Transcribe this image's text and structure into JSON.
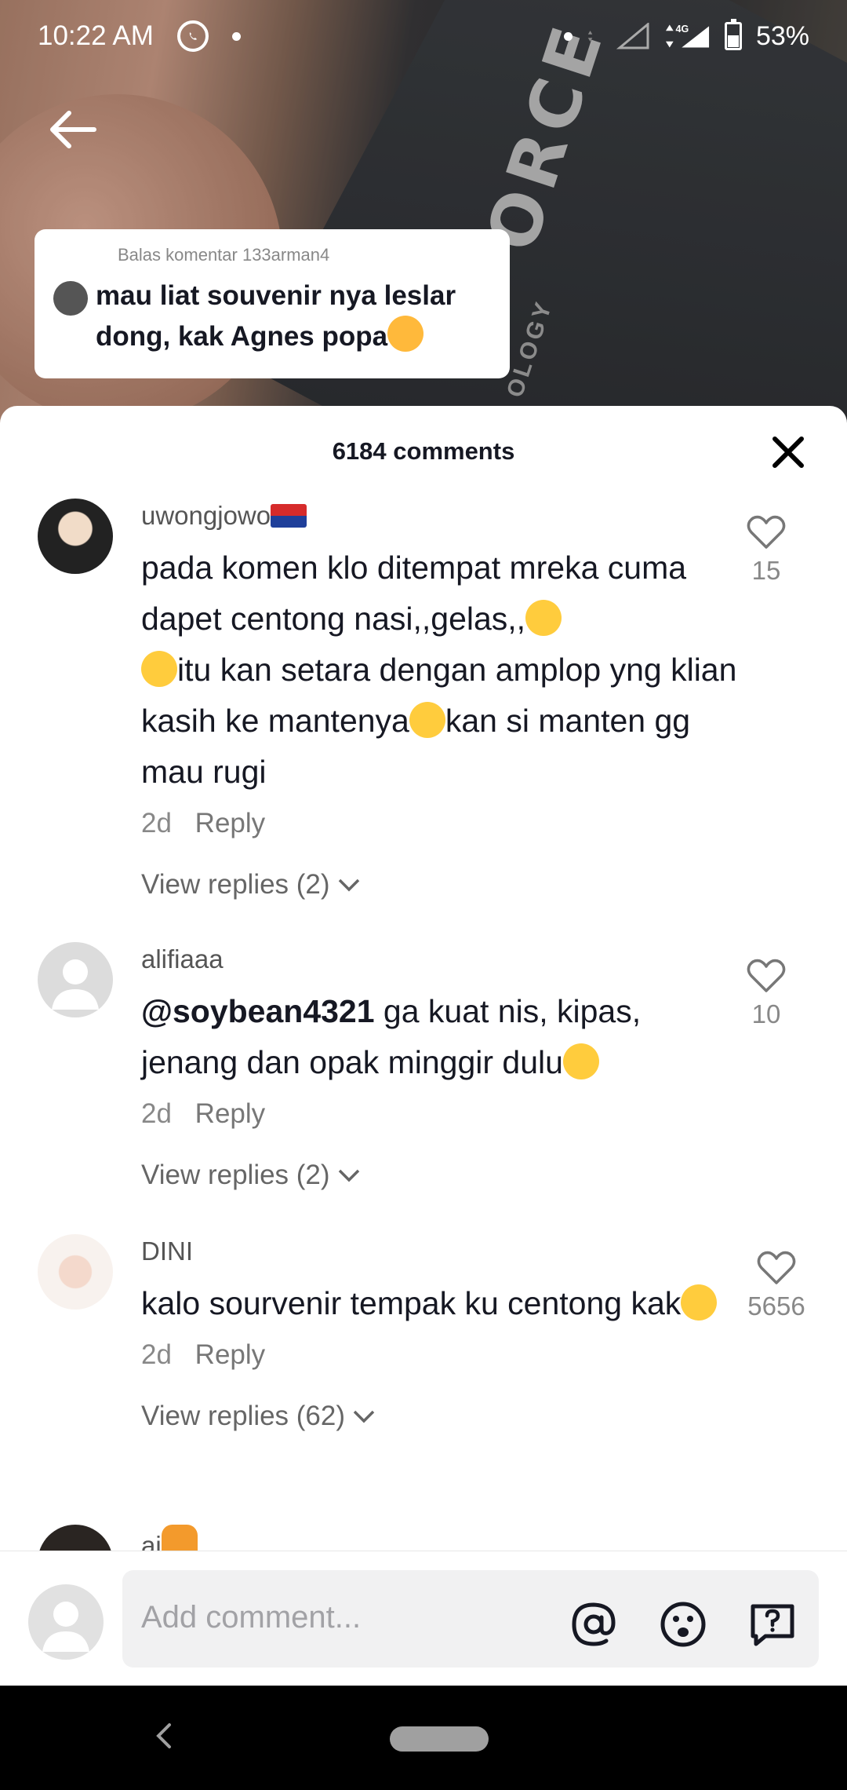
{
  "status_bar": {
    "time": "10:22 AM",
    "network": "4G",
    "battery": "53%"
  },
  "video": {
    "box_text": "ORCE",
    "box_subtext": "OLOGY"
  },
  "reply_bubble": {
    "header": "Balas komentar 133arman4",
    "text": "mau liat souvenir nya leslar dong, kak Agnes popa"
  },
  "sheet": {
    "title": "6184 comments"
  },
  "comments": [
    {
      "username": "uwongjowo",
      "text_parts": [
        "pada komen klo ditempat mreka cuma dapet centong nasi,,gelas,,",
        "",
        "itu kan setara dengan amplop yng klian kasih ke mantenya",
        "kan si manten gg mau rugi"
      ],
      "time": "2d",
      "reply_label": "Reply",
      "view_replies": "View replies (2)",
      "likes": "15"
    },
    {
      "username": "alifiaaa",
      "mention": "@soybean4321",
      "text": " ga kuat nis, kipas, jenang dan opak minggir dulu",
      "time": "2d",
      "reply_label": "Reply",
      "view_replies": "View replies (2)",
      "likes": "10"
    },
    {
      "username": "DINI",
      "text": "kalo sourvenir tempak ku centong kak",
      "time": "2d",
      "reply_label": "Reply",
      "view_replies": "View replies (62)",
      "likes": "5656"
    },
    {
      "username": "ai"
    }
  ],
  "input": {
    "placeholder": "Add comment..."
  },
  "colors": {
    "text_primary": "#161823",
    "text_secondary": "#888888",
    "sheet_bg": "#ffffff",
    "input_bg": "#f1f1f2"
  }
}
